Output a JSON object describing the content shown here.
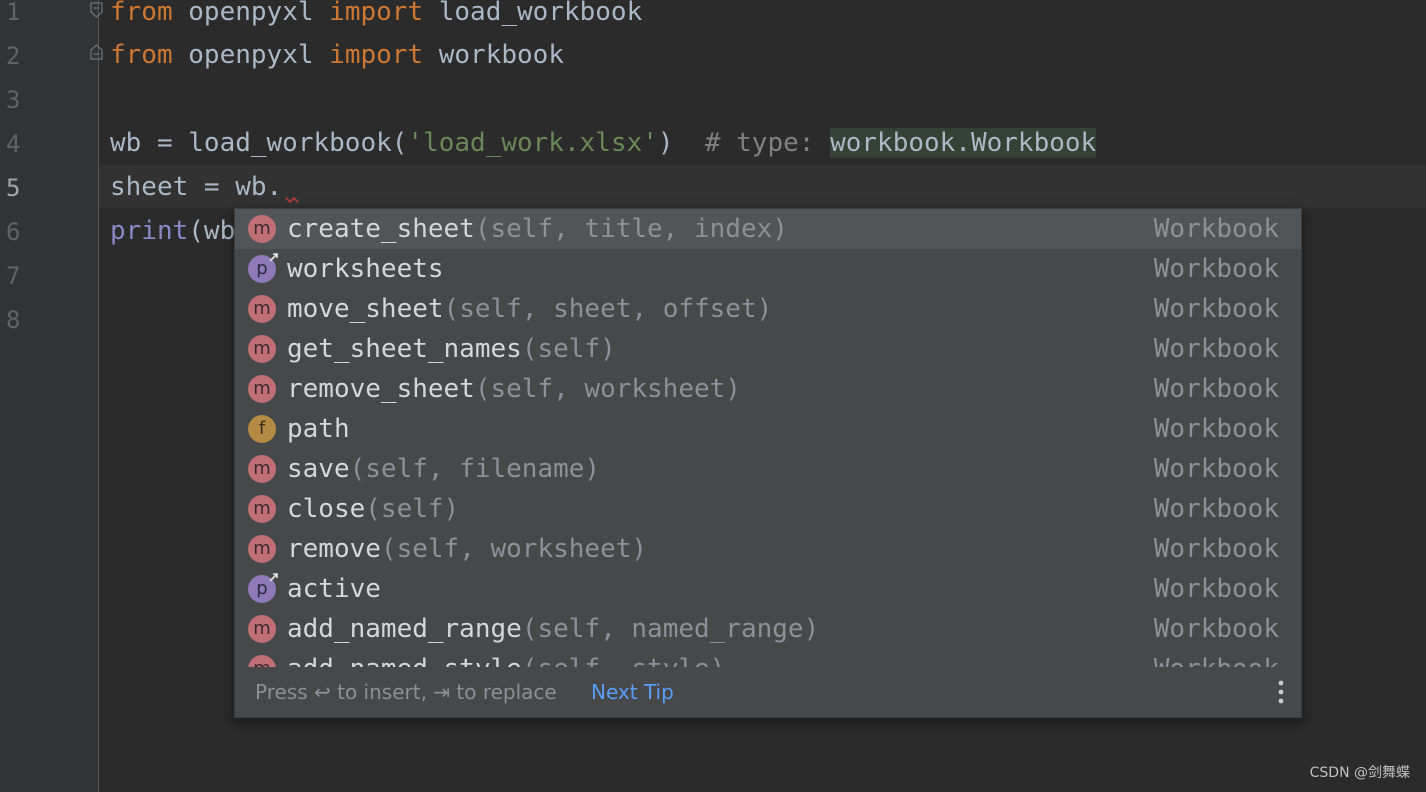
{
  "editor": {
    "line_numbers": [
      "1",
      "2",
      "3",
      "4",
      "5",
      "6",
      "7",
      "8"
    ],
    "current_line": "5",
    "lines": {
      "l1": {
        "kw1": "from",
        "mod": " openpyxl ",
        "kw2": "import",
        "name": " load_workbook"
      },
      "l2": {
        "kw1": "from",
        "mod": " openpyxl ",
        "kw2": "import",
        "name": " workbook"
      },
      "l4": {
        "pre": "wb = load_workbook(",
        "str": "'load_work.xlsx'",
        "post": ")  ",
        "cmt": "# type: ",
        "type": "workbook.Workbook"
      },
      "l5": {
        "text": "sheet = wb."
      },
      "l6": {
        "builtin": "print",
        "rest": "(wb"
      }
    }
  },
  "completion": {
    "items": [
      {
        "icon": "m",
        "name": "create_sheet",
        "sig": "(self, title, index)",
        "type": "Workbook"
      },
      {
        "icon": "p",
        "name": "worksheets",
        "sig": "",
        "type": "Workbook"
      },
      {
        "icon": "m",
        "name": "move_sheet",
        "sig": "(self, sheet, offset)",
        "type": "Workbook"
      },
      {
        "icon": "m",
        "name": "get_sheet_names",
        "sig": "(self)",
        "type": "Workbook"
      },
      {
        "icon": "m",
        "name": "remove_sheet",
        "sig": "(self, worksheet)",
        "type": "Workbook"
      },
      {
        "icon": "f",
        "name": "path",
        "sig": "",
        "type": "Workbook"
      },
      {
        "icon": "m",
        "name": "save",
        "sig": "(self, filename)",
        "type": "Workbook"
      },
      {
        "icon": "m",
        "name": "close",
        "sig": "(self)",
        "type": "Workbook"
      },
      {
        "icon": "m",
        "name": "remove",
        "sig": "(self, worksheet)",
        "type": "Workbook"
      },
      {
        "icon": "p",
        "name": "active",
        "sig": "",
        "type": "Workbook"
      },
      {
        "icon": "m",
        "name": "add_named_range",
        "sig": "(self, named_range)",
        "type": "Workbook"
      },
      {
        "icon": "m",
        "name": "add_named_style",
        "sig": "(self, style)",
        "type": "Workbook"
      }
    ],
    "footer": {
      "hint": "Press ↩ to insert, ⇥ to replace",
      "next_tip": "Next Tip"
    }
  },
  "watermark": "CSDN @剑舞蝶",
  "colors": {
    "background": "#2b2b2b",
    "keyword": "#cc7832",
    "string": "#6a8759",
    "popup": "#46484a",
    "link": "#589df6"
  }
}
